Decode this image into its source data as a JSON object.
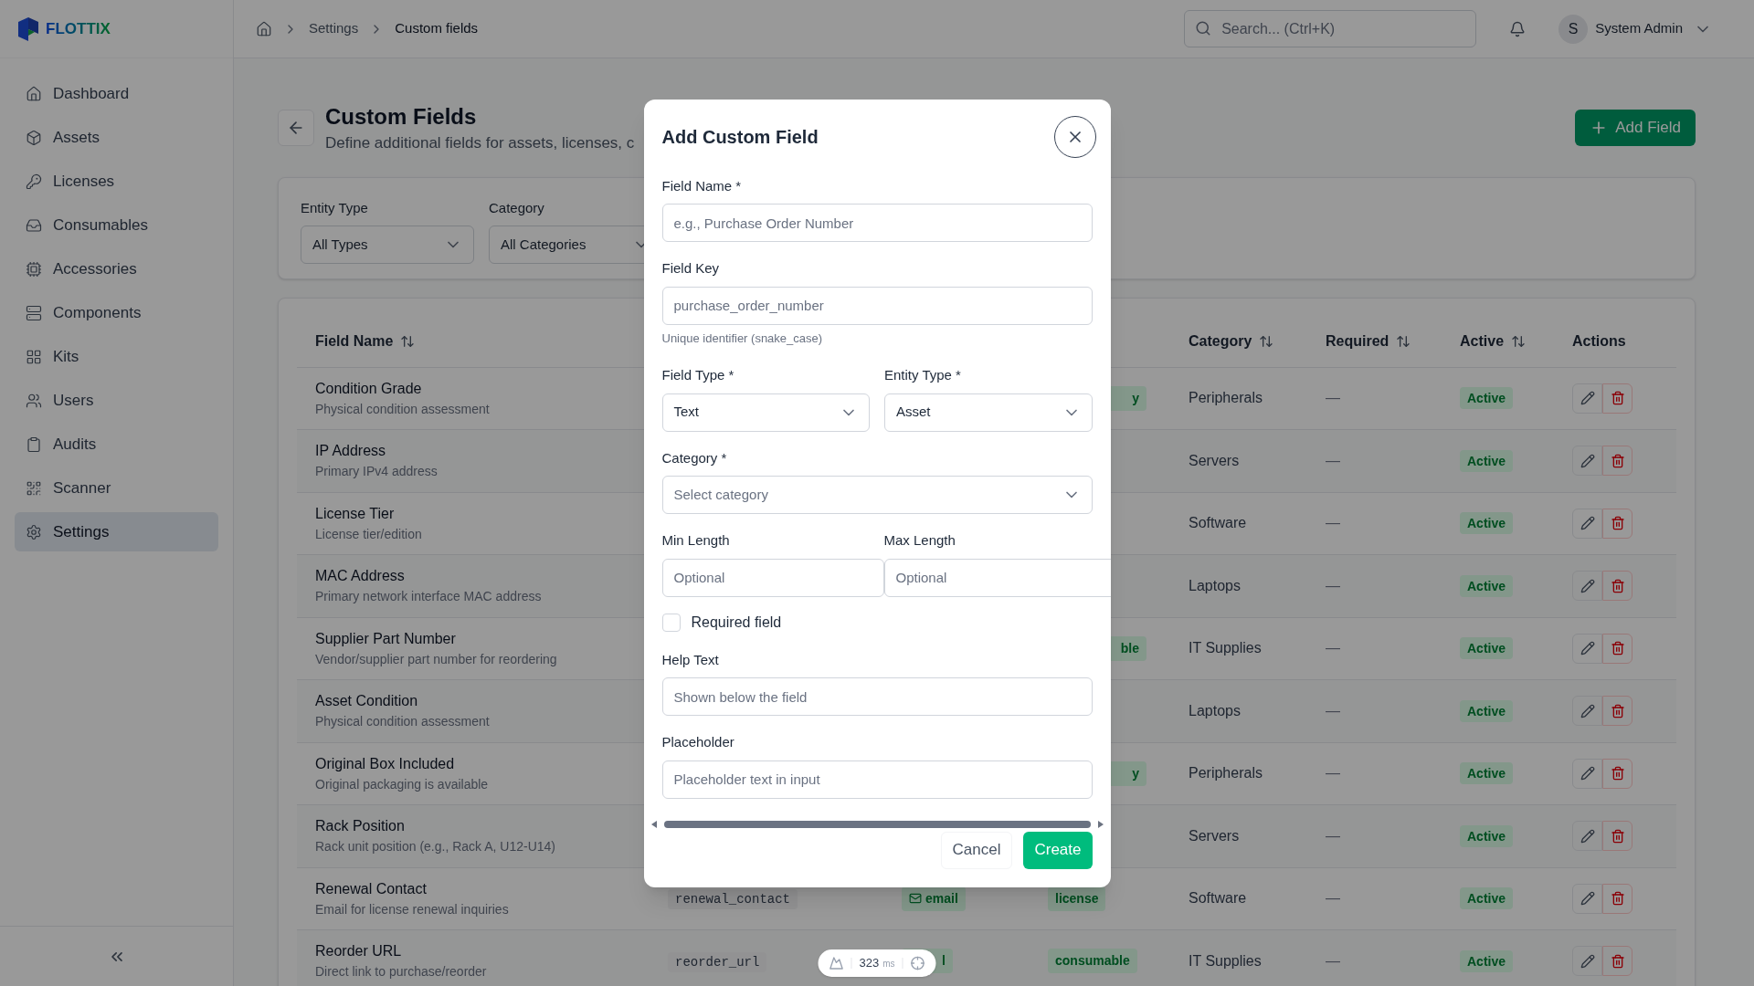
{
  "app": {
    "logo": "FLOTTIX"
  },
  "breadcrumb": {
    "items": [
      "Settings"
    ],
    "current": "Custom fields"
  },
  "search": {
    "placeholder": "Search... (Ctrl+K)"
  },
  "user": {
    "initial": "S",
    "name": "System Admin"
  },
  "sidebar": {
    "items": [
      {
        "label": "Dashboard",
        "selected": false
      },
      {
        "label": "Assets",
        "selected": false
      },
      {
        "label": "Licenses",
        "selected": false
      },
      {
        "label": "Consumables",
        "selected": false
      },
      {
        "label": "Accessories",
        "selected": false
      },
      {
        "label": "Components",
        "selected": false
      },
      {
        "label": "Kits",
        "selected": false
      },
      {
        "label": "Users",
        "selected": false
      },
      {
        "label": "Audits",
        "selected": false
      },
      {
        "label": "Scanner",
        "selected": false
      },
      {
        "label": "Settings",
        "selected": true
      }
    ]
  },
  "page": {
    "title": "Custom Fields",
    "subtitle": "Define additional fields for assets, licenses, c",
    "add_button": "Add Field"
  },
  "filters": [
    {
      "label": "Entity Type",
      "value": "All Types"
    },
    {
      "label": "Category",
      "value": "All Categories"
    }
  ],
  "table": {
    "columns": [
      {
        "label": "Field Name",
        "sortable": true
      },
      {
        "label": "Category",
        "sortable": true
      },
      {
        "label": "Required",
        "sortable": true
      },
      {
        "label": "Active",
        "sortable": true
      },
      {
        "label": "Actions",
        "sortable": false
      }
    ],
    "rows": [
      {
        "name": "Condition Grade",
        "description": "Physical condition assessment",
        "entity": {
          "text": "y",
          "kind": "partial"
        },
        "category": "Peripherals",
        "required": "—",
        "active": "Active"
      },
      {
        "name": "IP Address",
        "description": "Primary IPv4 address",
        "category": "Servers",
        "required": "—",
        "active": "Active"
      },
      {
        "name": "License Tier",
        "description": "License tier/edition",
        "category": "Software",
        "required": "—",
        "active": "Active"
      },
      {
        "name": "MAC Address",
        "description": "Primary network interface MAC address",
        "category": "Laptops",
        "required": "—",
        "active": "Active"
      },
      {
        "name": "Supplier Part Number",
        "description": "Vendor/supplier part number for reordering",
        "entity": {
          "text": "ble",
          "kind": "partial"
        },
        "category": "IT Supplies",
        "required": "—",
        "active": "Active"
      },
      {
        "name": "Asset Condition",
        "description": "Physical condition assessment",
        "category": "Laptops",
        "required": "—",
        "active": "Active"
      },
      {
        "name": "Original Box Included",
        "description": "Original packaging is available",
        "entity": {
          "text": "y",
          "kind": "partial"
        },
        "category": "Peripherals",
        "required": "—",
        "active": "Active"
      },
      {
        "name": "Rack Position",
        "description": "Rack unit position (e.g., Rack A, U12-U14)",
        "category": "Servers",
        "required": "—",
        "active": "Active"
      },
      {
        "name": "Renewal Contact",
        "description": "Email for license renewal inquiries",
        "key": "renewal_contact",
        "type": {
          "text": "email",
          "kind": "email"
        },
        "entity": {
          "text": "license",
          "kind": "full"
        },
        "category": "Software",
        "required": "—",
        "active": "Active"
      },
      {
        "name": "Reorder URL",
        "description": "Direct link to purchase/reorder",
        "key": "reorder_url",
        "type": {
          "text": "l",
          "kind": "partial"
        },
        "entity": {
          "text": "consumable",
          "kind": "full"
        },
        "category": "IT Supplies",
        "required": "—",
        "active": "Active"
      }
    ]
  },
  "modal": {
    "title": "Add Custom Field",
    "field_name": {
      "label": "Field Name *",
      "placeholder": "e.g., Purchase Order Number"
    },
    "field_key": {
      "label": "Field Key",
      "placeholder": "purchase_order_number",
      "hint": "Unique identifier (snake_case)"
    },
    "field_type": {
      "label": "Field Type *",
      "value": "Text"
    },
    "entity_type": {
      "label": "Entity Type *",
      "value": "Asset"
    },
    "category": {
      "label": "Category *",
      "placeholder": "Select category"
    },
    "min_length": {
      "label": "Min Length",
      "placeholder": "Optional"
    },
    "max_length": {
      "label": "Max Length",
      "placeholder": "Optional"
    },
    "required_checkbox": {
      "label": "Required field",
      "checked": false
    },
    "help_text": {
      "label": "Help Text",
      "placeholder": "Shown below the field"
    },
    "placeholder_field": {
      "label": "Placeholder",
      "placeholder": "Placeholder text in input"
    },
    "cancel": "Cancel",
    "create": "Create"
  },
  "dev_toolbar": {
    "timing": "323",
    "unit": "ms"
  }
}
